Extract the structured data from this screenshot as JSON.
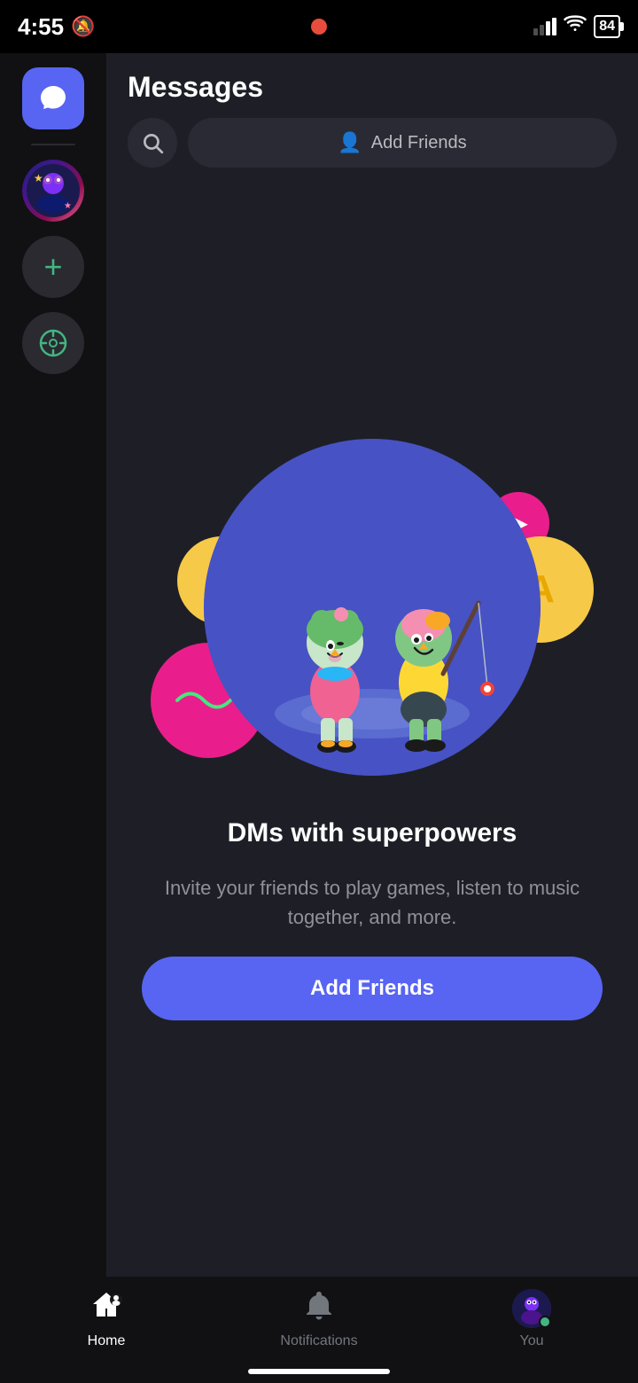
{
  "statusBar": {
    "time": "4:55",
    "mute": true,
    "battery": "84"
  },
  "sidebar": {
    "items": [
      {
        "id": "messages",
        "label": "Messages",
        "active": true
      },
      {
        "id": "server1",
        "label": "Server"
      },
      {
        "id": "add",
        "label": "Add Server"
      },
      {
        "id": "discover",
        "label": "Discover"
      }
    ]
  },
  "header": {
    "title": "Messages",
    "addFriendsLabel": "Add Friends",
    "searchPlaceholder": "Search"
  },
  "emptyState": {
    "title": "DMs with superpowers",
    "description": "Invite your friends to play games, listen to music together, and more.",
    "addFriendsButton": "Add Friends"
  },
  "bottomNav": {
    "items": [
      {
        "id": "home",
        "label": "Home",
        "icon": "🏠",
        "active": true
      },
      {
        "id": "notifications",
        "label": "Notifications",
        "icon": "🔔",
        "active": false
      },
      {
        "id": "you",
        "label": "You",
        "icon": "avatar",
        "active": false
      }
    ]
  }
}
